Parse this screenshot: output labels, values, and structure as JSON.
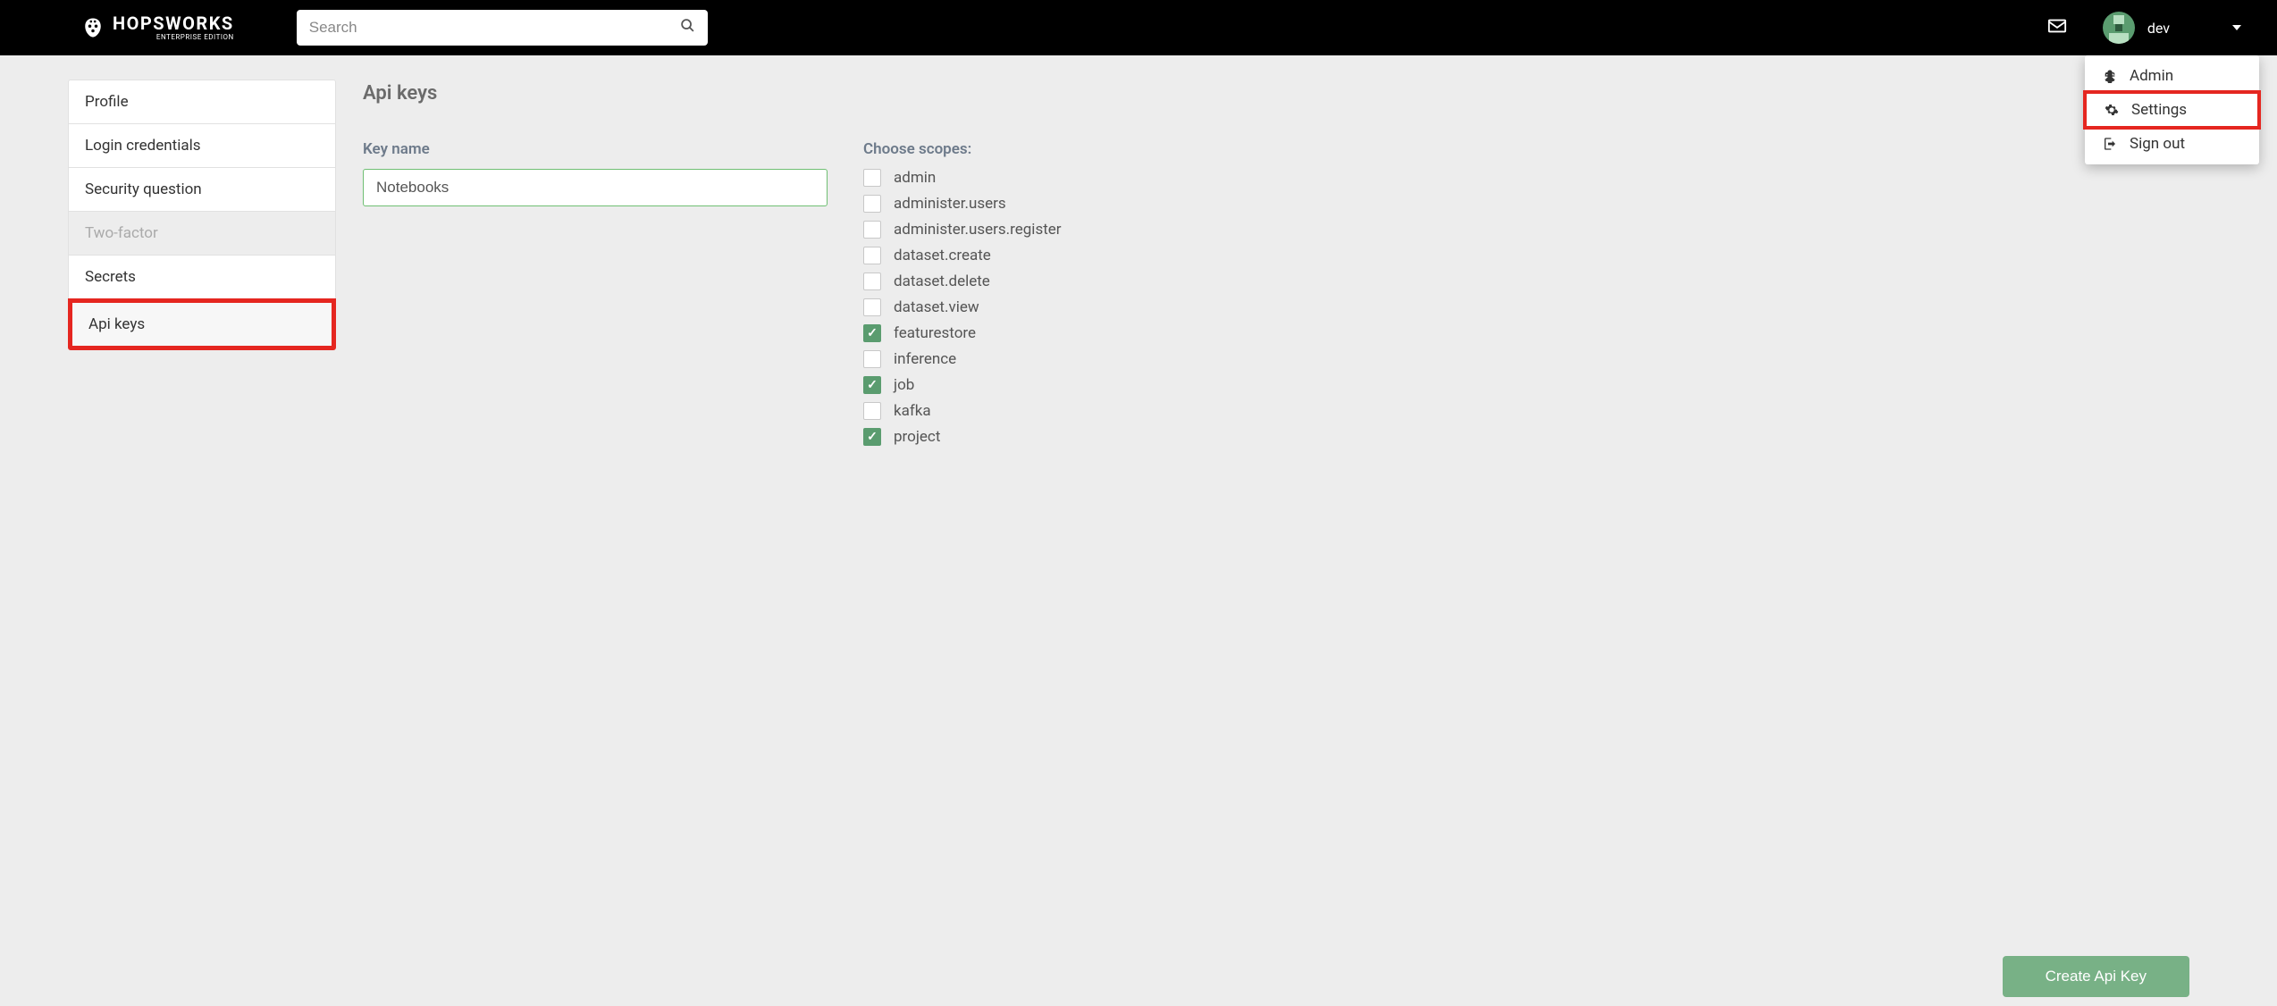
{
  "brand": {
    "name": "HOPSWORKS",
    "subtitle": "ENTERPRISE EDITION"
  },
  "search": {
    "placeholder": "Search"
  },
  "user": {
    "name": "dev"
  },
  "dropdown": {
    "items": [
      {
        "label": "Admin",
        "icon": "bug",
        "highlight": false
      },
      {
        "label": "Settings",
        "icon": "gear",
        "highlight": true
      },
      {
        "label": "Sign out",
        "icon": "signout",
        "highlight": false
      }
    ]
  },
  "sidebar": {
    "items": [
      {
        "label": "Profile",
        "state": "normal"
      },
      {
        "label": "Login credentials",
        "state": "normal"
      },
      {
        "label": "Security question",
        "state": "normal"
      },
      {
        "label": "Two-factor",
        "state": "disabled"
      },
      {
        "label": "Secrets",
        "state": "normal"
      },
      {
        "label": "Api keys",
        "state": "active"
      }
    ]
  },
  "page": {
    "title": "Api keys",
    "key_name_label": "Key name",
    "key_name_value": "Notebooks",
    "scopes_label": "Choose scopes:",
    "scopes": [
      {
        "label": "admin",
        "checked": false
      },
      {
        "label": "administer.users",
        "checked": false
      },
      {
        "label": "administer.users.register",
        "checked": false
      },
      {
        "label": "dataset.create",
        "checked": false
      },
      {
        "label": "dataset.delete",
        "checked": false
      },
      {
        "label": "dataset.view",
        "checked": false
      },
      {
        "label": "featurestore",
        "checked": true
      },
      {
        "label": "inference",
        "checked": false
      },
      {
        "label": "job",
        "checked": true
      },
      {
        "label": "kafka",
        "checked": false
      },
      {
        "label": "project",
        "checked": true
      }
    ],
    "create_button": "Create Api Key"
  }
}
